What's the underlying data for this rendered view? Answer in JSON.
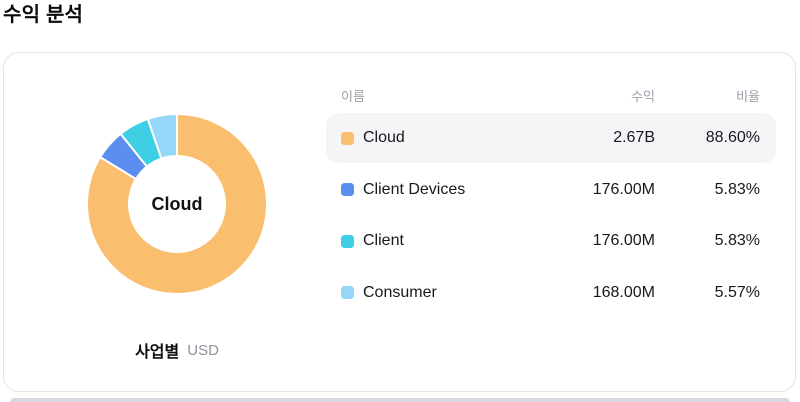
{
  "page": {
    "title": "수익 분석"
  },
  "card": {
    "donut": {
      "center_label": "Cloud",
      "footer": {
        "group_label": "사업별",
        "unit": "USD"
      }
    },
    "table": {
      "headers": {
        "name": "이름",
        "revenue": "수익",
        "ratio": "비율"
      },
      "rows": [
        {
          "name": "Cloud",
          "revenue": "2.67B",
          "ratio": "88.60%",
          "color": "#f9be6e",
          "highlighted": true
        },
        {
          "name": "Client Devices",
          "revenue": "176.00M",
          "ratio": "5.83%",
          "color": "#5c8ef0",
          "highlighted": false
        },
        {
          "name": "Client",
          "revenue": "176.00M",
          "ratio": "5.83%",
          "color": "#3ecfe4",
          "highlighted": false
        },
        {
          "name": "Consumer",
          "revenue": "168.00M",
          "ratio": "5.57%",
          "color": "#94d7f8",
          "highlighted": false
        }
      ]
    }
  },
  "chart_data": {
    "type": "pie",
    "donut": true,
    "title": "수익 분석",
    "group_label": "사업별",
    "unit": "USD",
    "center_label": "Cloud",
    "categories": [
      "Cloud",
      "Client Devices",
      "Client",
      "Consumer"
    ],
    "values": [
      2670000000,
      176000000,
      176000000,
      168000000
    ],
    "value_labels": [
      "2.67B",
      "176.00M",
      "176.00M",
      "168.00M"
    ],
    "ratios_pct": [
      88.6,
      5.83,
      5.83,
      5.57
    ],
    "colors": [
      "#f9be6e",
      "#5c8ef0",
      "#3ecfe4",
      "#94d7f8"
    ],
    "start_angle_deg": 0,
    "direction": "clockwise",
    "inner_radius_px": 48,
    "outer_radius_px": 90,
    "segment_gap_color": "#ffffff"
  }
}
